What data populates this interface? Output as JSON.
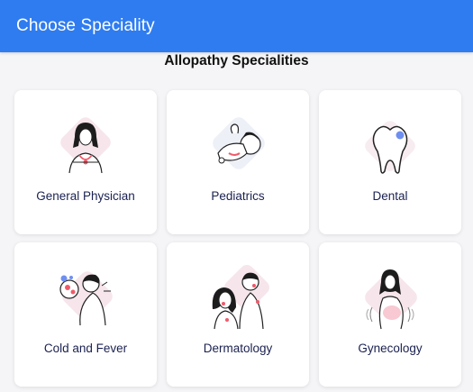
{
  "header": {
    "title": "Choose Speciality"
  },
  "section": {
    "title": "Allopathy Specialities"
  },
  "specialities": [
    {
      "label": "General Physician",
      "icon": "doctor-stethoscope-icon"
    },
    {
      "label": "Pediatrics",
      "icon": "baby-icon"
    },
    {
      "label": "Dental",
      "icon": "tooth-icon"
    },
    {
      "label": "Cold and Fever",
      "icon": "virus-sick-person-icon"
    },
    {
      "label": "Dermatology",
      "icon": "skin-couple-icon"
    },
    {
      "label": "Gynecology",
      "icon": "pregnant-woman-icon"
    }
  ],
  "colors": {
    "app_bar": "#2f7cf0",
    "accent_blob": "#f6dfe6",
    "accent_red": "#ef5a6a",
    "accent_blue": "#6f8ff0",
    "label_text": "#1a2150"
  }
}
